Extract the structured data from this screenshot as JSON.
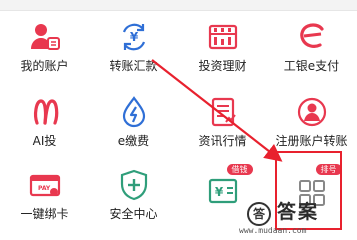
{
  "colors": {
    "red": "#e8384f",
    "blue": "#2f6fd6",
    "highlight": "#e8212e"
  },
  "grid": [
    {
      "label": "我的账户",
      "icon": "account-user-icon"
    },
    {
      "label": "转账汇款",
      "icon": "transfer-yen-icon"
    },
    {
      "label": "投资理财",
      "icon": "abacus-icon"
    },
    {
      "label": "工银e支付",
      "icon": "e-pay-icon"
    },
    {
      "label": "AI投",
      "icon": "ai-invest-icon"
    },
    {
      "label": "e缴费",
      "icon": "payment-drop-icon"
    },
    {
      "label": "资讯行情",
      "icon": "news-document-icon"
    },
    {
      "label": "注册账户转账",
      "icon": "registered-account-icon"
    },
    {
      "label": "一键绑卡",
      "icon": "bind-card-icon"
    },
    {
      "label": "安全中心",
      "icon": "security-shield-icon"
    },
    {
      "label": "",
      "icon": "loan-yen-icon",
      "badge": "借钱"
    },
    {
      "label": "",
      "icon": "more-grid-icon",
      "badge": "排号"
    }
  ],
  "watermark": {
    "logo": "答",
    "text": "答案",
    "url": "www.mudaan.com"
  }
}
